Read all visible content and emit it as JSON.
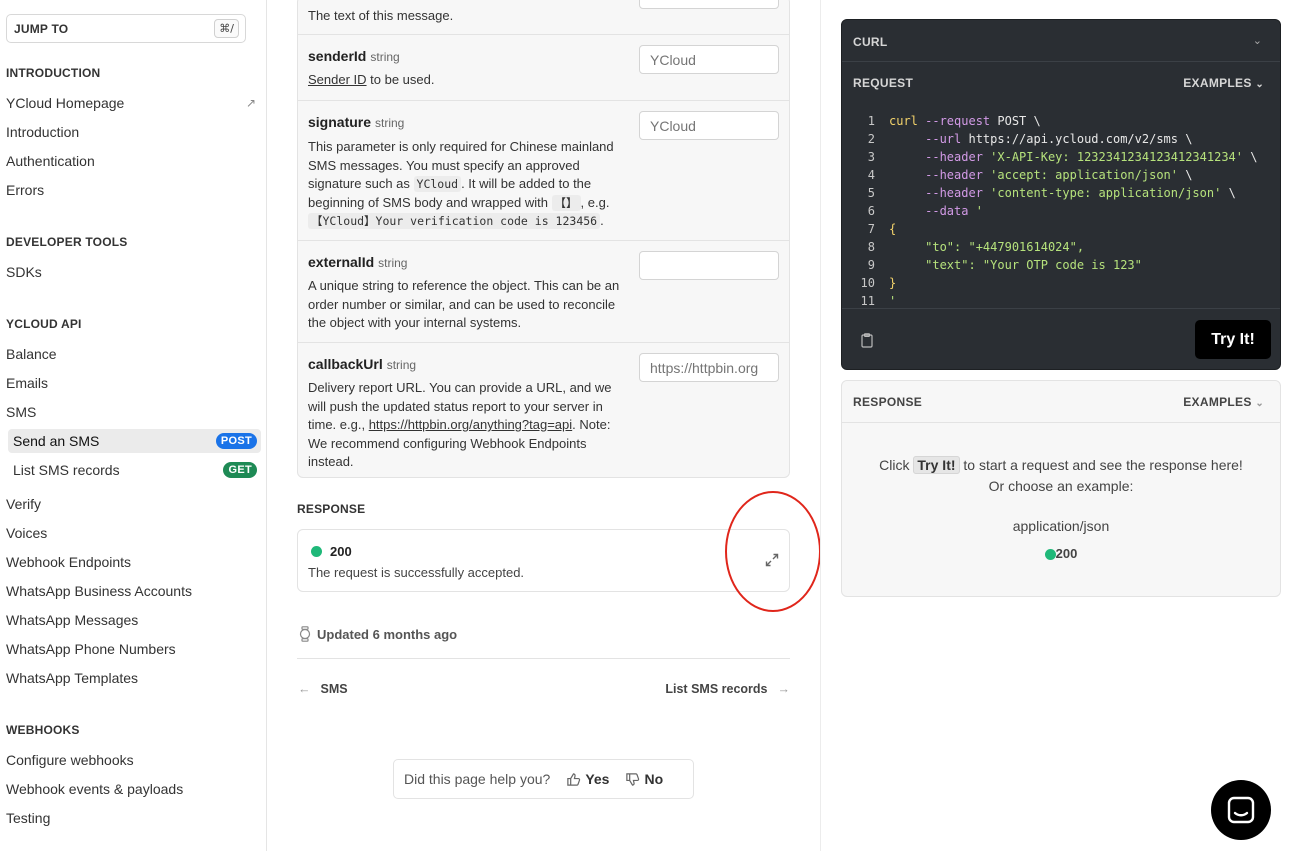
{
  "sidebar": {
    "jump_label": "JUMP TO",
    "jump_shortcut": "⌘/",
    "sections": {
      "introduction": "INTRODUCTION",
      "developer_tools": "DEVELOPER TOOLS",
      "ycloud_api": "YCLOUD API",
      "webhooks": "WEBHOOKS"
    },
    "intro_items": [
      "YCloud Homepage",
      "Introduction",
      "Authentication",
      "Errors"
    ],
    "devtools_items": [
      "SDKs"
    ],
    "api_items": [
      "Balance",
      "Emails",
      "SMS"
    ],
    "sms_items": [
      {
        "label": "Send an SMS",
        "badge": "POST"
      },
      {
        "label": "List SMS records",
        "badge": "GET"
      }
    ],
    "api_items_2": [
      "Verify",
      "Voices",
      "Webhook Endpoints",
      "WhatsApp Business Accounts",
      "WhatsApp Messages",
      "WhatsApp Phone Numbers",
      "WhatsApp Templates"
    ],
    "webhook_items": [
      "Configure webhooks",
      "Webhook events & payloads",
      "Testing"
    ]
  },
  "params": {
    "text_desc": "The text of this message.",
    "senderId": {
      "name": "senderId",
      "type": "string",
      "link": "Sender ID",
      "desc_rest": " to be used.",
      "placeholder": "YCloud"
    },
    "signature": {
      "name": "signature",
      "type": "string",
      "desc_1": "This parameter is only required for Chinese mainland SMS messages. You must specify an approved signature such as ",
      "code_1": "YCloud",
      "desc_2": ". It will be added to the beginning of SMS body and wrapped with ",
      "code_2": "【】",
      "desc_3": ", e.g. ",
      "code_3": "【YCloud】Your verification code is 123456",
      "desc_4": ".",
      "placeholder": "YCloud"
    },
    "externalId": {
      "name": "externalId",
      "type": "string",
      "desc": "A unique string to reference the object. This can be an order number or similar, and can be used to reconcile the object with your internal systems.",
      "placeholder": ""
    },
    "callbackUrl": {
      "name": "callbackUrl",
      "type": "string",
      "desc_1": "Delivery report URL. You can provide a URL, and we will push the updated status report to your server in time. e.g., ",
      "link": "https://httpbin.org/anything?tag=api",
      "desc_2": ". Note: We recommend configuring Webhook Endpoints instead.",
      "placeholder": "https://httpbin.org"
    }
  },
  "response": {
    "label": "RESPONSE",
    "code": "200",
    "desc": "The request is successfully accepted."
  },
  "footer": {
    "updated": "Updated 6 months ago",
    "prev": "SMS",
    "next": "List SMS records",
    "help_question": "Did this page help you?",
    "yes": "Yes",
    "no": "No"
  },
  "curl_panel": {
    "title": "CURL",
    "request_label": "REQUEST",
    "examples_label": "EXAMPLES",
    "try_label": "Try It!",
    "lines": [
      {
        "n": "1",
        "parts": [
          [
            "k-cmd",
            "curl"
          ],
          [
            "k-flag",
            " --request"
          ],
          [
            "k-plain",
            " POST \\"
          ]
        ]
      },
      {
        "n": "2",
        "parts": [
          [
            "k-plain",
            "     "
          ],
          [
            "k-flag",
            "--url"
          ],
          [
            "k-plain",
            " https://api.ycloud.com/v2/sms \\"
          ]
        ]
      },
      {
        "n": "3",
        "parts": [
          [
            "k-plain",
            "     "
          ],
          [
            "k-flag",
            "--header"
          ],
          [
            "k-str",
            " 'X-API-Key: 1232341234123412341234'"
          ],
          [
            "k-plain",
            " \\"
          ]
        ]
      },
      {
        "n": "4",
        "parts": [
          [
            "k-plain",
            "     "
          ],
          [
            "k-flag",
            "--header"
          ],
          [
            "k-str",
            " 'accept: application/json'"
          ],
          [
            "k-plain",
            " \\"
          ]
        ]
      },
      {
        "n": "5",
        "parts": [
          [
            "k-plain",
            "     "
          ],
          [
            "k-flag",
            "--header"
          ],
          [
            "k-str",
            " 'content-type: application/json'"
          ],
          [
            "k-plain",
            " \\"
          ]
        ]
      },
      {
        "n": "6",
        "parts": [
          [
            "k-plain",
            "     "
          ],
          [
            "k-flag",
            "--data"
          ],
          [
            "k-str",
            " '"
          ]
        ]
      },
      {
        "n": "7",
        "parts": [
          [
            "k-cmd",
            "{"
          ]
        ]
      },
      {
        "n": "8",
        "parts": [
          [
            "k-plain",
            "     "
          ],
          [
            "k-str",
            "\"to\": \"+447901614024\","
          ]
        ]
      },
      {
        "n": "9",
        "parts": [
          [
            "k-plain",
            "     "
          ],
          [
            "k-str",
            "\"text\": \"Your OTP code is 123\""
          ]
        ]
      },
      {
        "n": "10",
        "parts": [
          [
            "k-cmd",
            "}"
          ]
        ]
      },
      {
        "n": "11",
        "parts": [
          [
            "k-str",
            "'"
          ]
        ]
      }
    ]
  },
  "response_panel": {
    "title": "RESPONSE",
    "examples_label": "EXAMPLES",
    "msg_pre": "Click ",
    "msg_tag": "Try It!",
    "msg_post": " to start a request and see the response here!",
    "msg_line2": "Or choose an example:",
    "content_type": "application/json",
    "code": "200"
  },
  "colors": {
    "post_badge": "#1a73e8",
    "get_badge": "#1e8a55",
    "status_ok": "#1fb879",
    "annotation": "#e0261b"
  }
}
